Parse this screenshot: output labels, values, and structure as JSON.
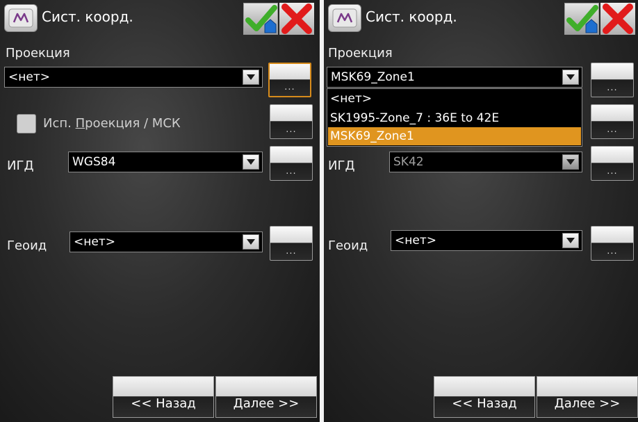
{
  "left": {
    "title": "Сист. коорд.",
    "projection_label": "Проекция",
    "projection_value": "<нет>",
    "use_projection_label_prefix": "Исп. ",
    "use_projection_label_underlined": "П",
    "use_projection_label_rest": "роекция / МСК",
    "datum_label": "ИГД",
    "datum_value": "WGS84",
    "geoid_label": "Геоид",
    "geoid_value": "<нет>",
    "more_label": "...",
    "back_label": "<< Назад",
    "next_label": "Далее >>"
  },
  "right": {
    "title": "Сист. коорд.",
    "projection_label": "Проекция",
    "projection_value": "MSK69_Zone1",
    "dropdown_options": [
      "<нет>",
      "SK1995-Zone_7 : 36E to 42E",
      "MSK69_Zone1"
    ],
    "selected_option_index": 2,
    "datum_label": "ИГД",
    "datum_value": "SK42",
    "geoid_label": "Геоид",
    "geoid_value": "<нет>",
    "more_label": "...",
    "back_label": "<< Назад",
    "next_label": "Далее >>"
  },
  "colors": {
    "accent": "#e0951f",
    "ok_check": "#3fae2a",
    "cancel_x": "#e11b1b",
    "background": "#2c2c2c"
  },
  "icons": {
    "app": "m-logo-icon",
    "ok": "check-home-icon",
    "cancel": "close-icon",
    "combo_arrow": "chevron-down-icon"
  }
}
